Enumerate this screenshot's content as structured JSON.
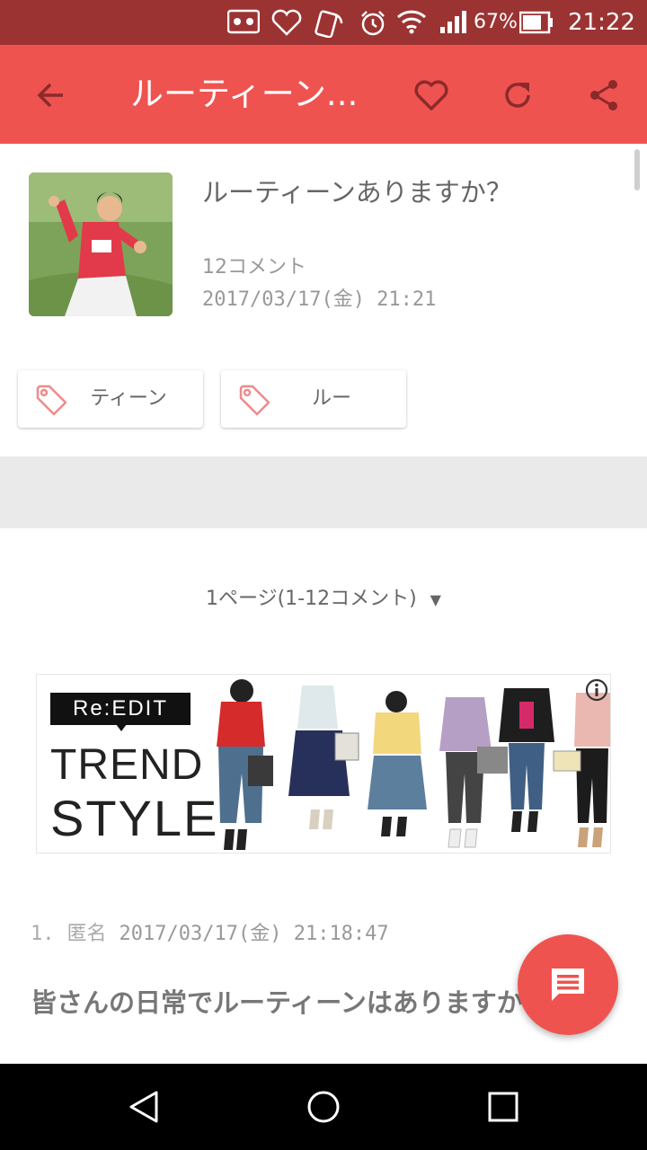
{
  "status_bar": {
    "icons": [
      "voicemail-icon",
      "heart-notification-icon",
      "nfc-icon",
      "alarm-icon",
      "wifi-icon",
      "signal-icon"
    ],
    "battery_percent": "67%",
    "time": "21:22"
  },
  "app_bar": {
    "title": "ルーティーン...",
    "icons": [
      "back-arrow-icon",
      "heart-icon",
      "refresh-icon",
      "share-icon"
    ]
  },
  "topic": {
    "title": "ルーティーンありますか？",
    "comment_count": "12コメント",
    "date": "2017/03/17(金) 21:21"
  },
  "tags": [
    {
      "label": "ティーン"
    },
    {
      "label": "ルー"
    }
  ],
  "pager": {
    "label": "1ページ(1-12コメント)",
    "arrow": "▼"
  },
  "ad": {
    "brand": "Re:EDIT",
    "line1": "TREND",
    "line2": "STYLE"
  },
  "comment": {
    "number": "1.",
    "author": "匿名",
    "datetime": "2017/03/17(金) 21:18:47",
    "body": "皆さんの日常でルーティーンはありますか？"
  },
  "colors": {
    "accent": "#ef5350",
    "status_bar": "#9c3333",
    "appbar_icon_dark": "#8b2a2a"
  }
}
